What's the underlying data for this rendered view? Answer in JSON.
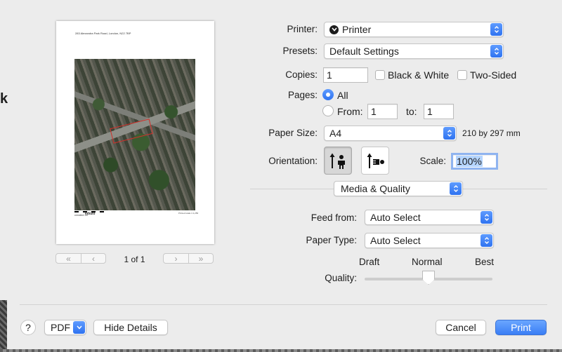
{
  "preview": {
    "address_line": "283 Alexandra Park Road, London, N22 7BP",
    "credit": "created on",
    "logo": "edozo",
    "scale_note": "Printed scale 1:1,250",
    "page_label": "1 of 1",
    "nav": {
      "first": "«",
      "prev": "‹",
      "next": "›",
      "last": "»"
    }
  },
  "printer": {
    "label": "Printer:",
    "value": "Printer",
    "icon": "printer-badge-icon"
  },
  "presets": {
    "label": "Presets:",
    "value": "Default Settings"
  },
  "copies": {
    "label": "Copies:",
    "value": "1",
    "bw_label": "Black & White",
    "two_sided_label": "Two-Sided"
  },
  "pages": {
    "label": "Pages:",
    "all_label": "All",
    "from_label": "From:",
    "from_value": "1",
    "to_label": "to:",
    "to_value": "1"
  },
  "paper_size": {
    "label": "Paper Size:",
    "value": "A4",
    "dimensions": "210 by 297 mm"
  },
  "orientation": {
    "label": "Orientation:",
    "portrait_icon": "portrait-orientation-icon",
    "landscape_icon": "landscape-orientation-icon"
  },
  "scale": {
    "label": "Scale:",
    "value": "100%"
  },
  "section": {
    "value": "Media & Quality"
  },
  "feed_from": {
    "label": "Feed from:",
    "value": "Auto Select"
  },
  "paper_type": {
    "label": "Paper Type:",
    "value": "Auto Select"
  },
  "quality": {
    "label": "Quality:",
    "draft": "Draft",
    "normal": "Normal",
    "best": "Best",
    "level": 0.5
  },
  "footer": {
    "help": "?",
    "pdf": "PDF",
    "hide_details": "Hide Details",
    "cancel": "Cancel",
    "print": "Print"
  },
  "colors": {
    "accent": "#3a7ef5",
    "selection": "#b5d5ff"
  }
}
